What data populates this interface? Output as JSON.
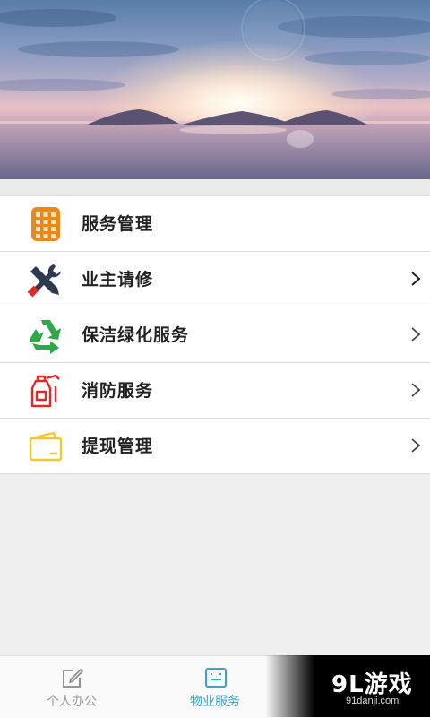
{
  "banner": {
    "image": "sunset-sea-landscape"
  },
  "menu": {
    "items": [
      {
        "label": "服务管理",
        "icon": "building-grid-icon",
        "color": "#e58a1f",
        "chevron": false
      },
      {
        "label": "业主请修",
        "icon": "tools-icon",
        "color": "#2e3a4f",
        "chevron": true
      },
      {
        "label": "保洁绿化服务",
        "icon": "recycle-icon",
        "color": "#2fa84a",
        "chevron": true
      },
      {
        "label": "消防服务",
        "icon": "fire-extinguisher-icon",
        "color": "#e02a2a",
        "chevron": true
      },
      {
        "label": "提现管理",
        "icon": "wallet-icon",
        "color": "#f2c830",
        "chevron": true
      }
    ]
  },
  "tabbar": {
    "tabs": [
      {
        "label": "个人办公",
        "icon": "edit-icon",
        "active": false
      },
      {
        "label": "物业服务",
        "icon": "service-icon",
        "active": true
      }
    ],
    "active_color": "#33a6d6"
  },
  "watermark": {
    "logo": "9L游戏",
    "url": "91danji.com"
  }
}
